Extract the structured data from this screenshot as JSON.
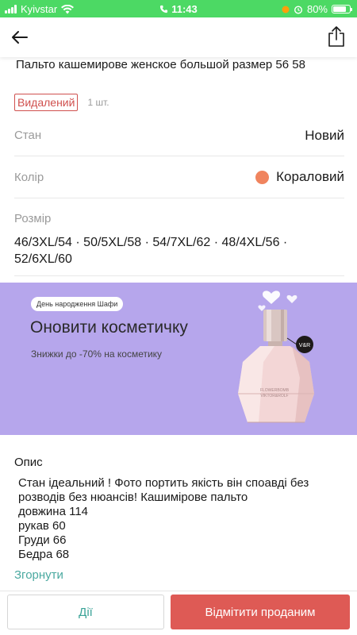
{
  "status_bar": {
    "carrier": "Kyivstar",
    "time": "11:43",
    "battery": "80%",
    "battery_level": 0.8,
    "background_color": "#4cd964"
  },
  "header": {
    "back_icon": "arrow-left-icon",
    "share_icon": "share-icon"
  },
  "product": {
    "title": "Пальто кашемирове женское большой размер 56 58",
    "status": "Видалений",
    "quantity": "1 шт.",
    "status_color": "#d0504e"
  },
  "attributes": {
    "condition_label": "Стан",
    "condition_value": "Новий",
    "color_label": "Колір",
    "color_value": "Кораловий",
    "color_swatch": "#f0845e",
    "size_label": "Розмір",
    "size_value": "46/3XL/54 · 50/5XL/58 · 54/7XL/62 · 48/4XL/56 · 52/6XL/60"
  },
  "banner": {
    "chip": "День народження Шафи",
    "title": "Оновити косметичку",
    "subtitle": "Знижки до -70% на косметику",
    "background_color": "#b6a6ec",
    "bottle_label_line1": "FLOWERBOMB",
    "bottle_label_line2": "VIKTOR&ROLF",
    "bottle_tag": "V&R"
  },
  "description": {
    "heading": "Опис",
    "text": "Стан ідеальний ! Фото портить якість він споавді без розводів без нюансів! Кашимірове пальто\n довжина 114\nрукав 60\nГруди 66\nБедра 68",
    "collapse": "Згорнути"
  },
  "bottom_bar": {
    "actions_label": "Дії",
    "mark_sold_label": "Відмітити проданим"
  }
}
